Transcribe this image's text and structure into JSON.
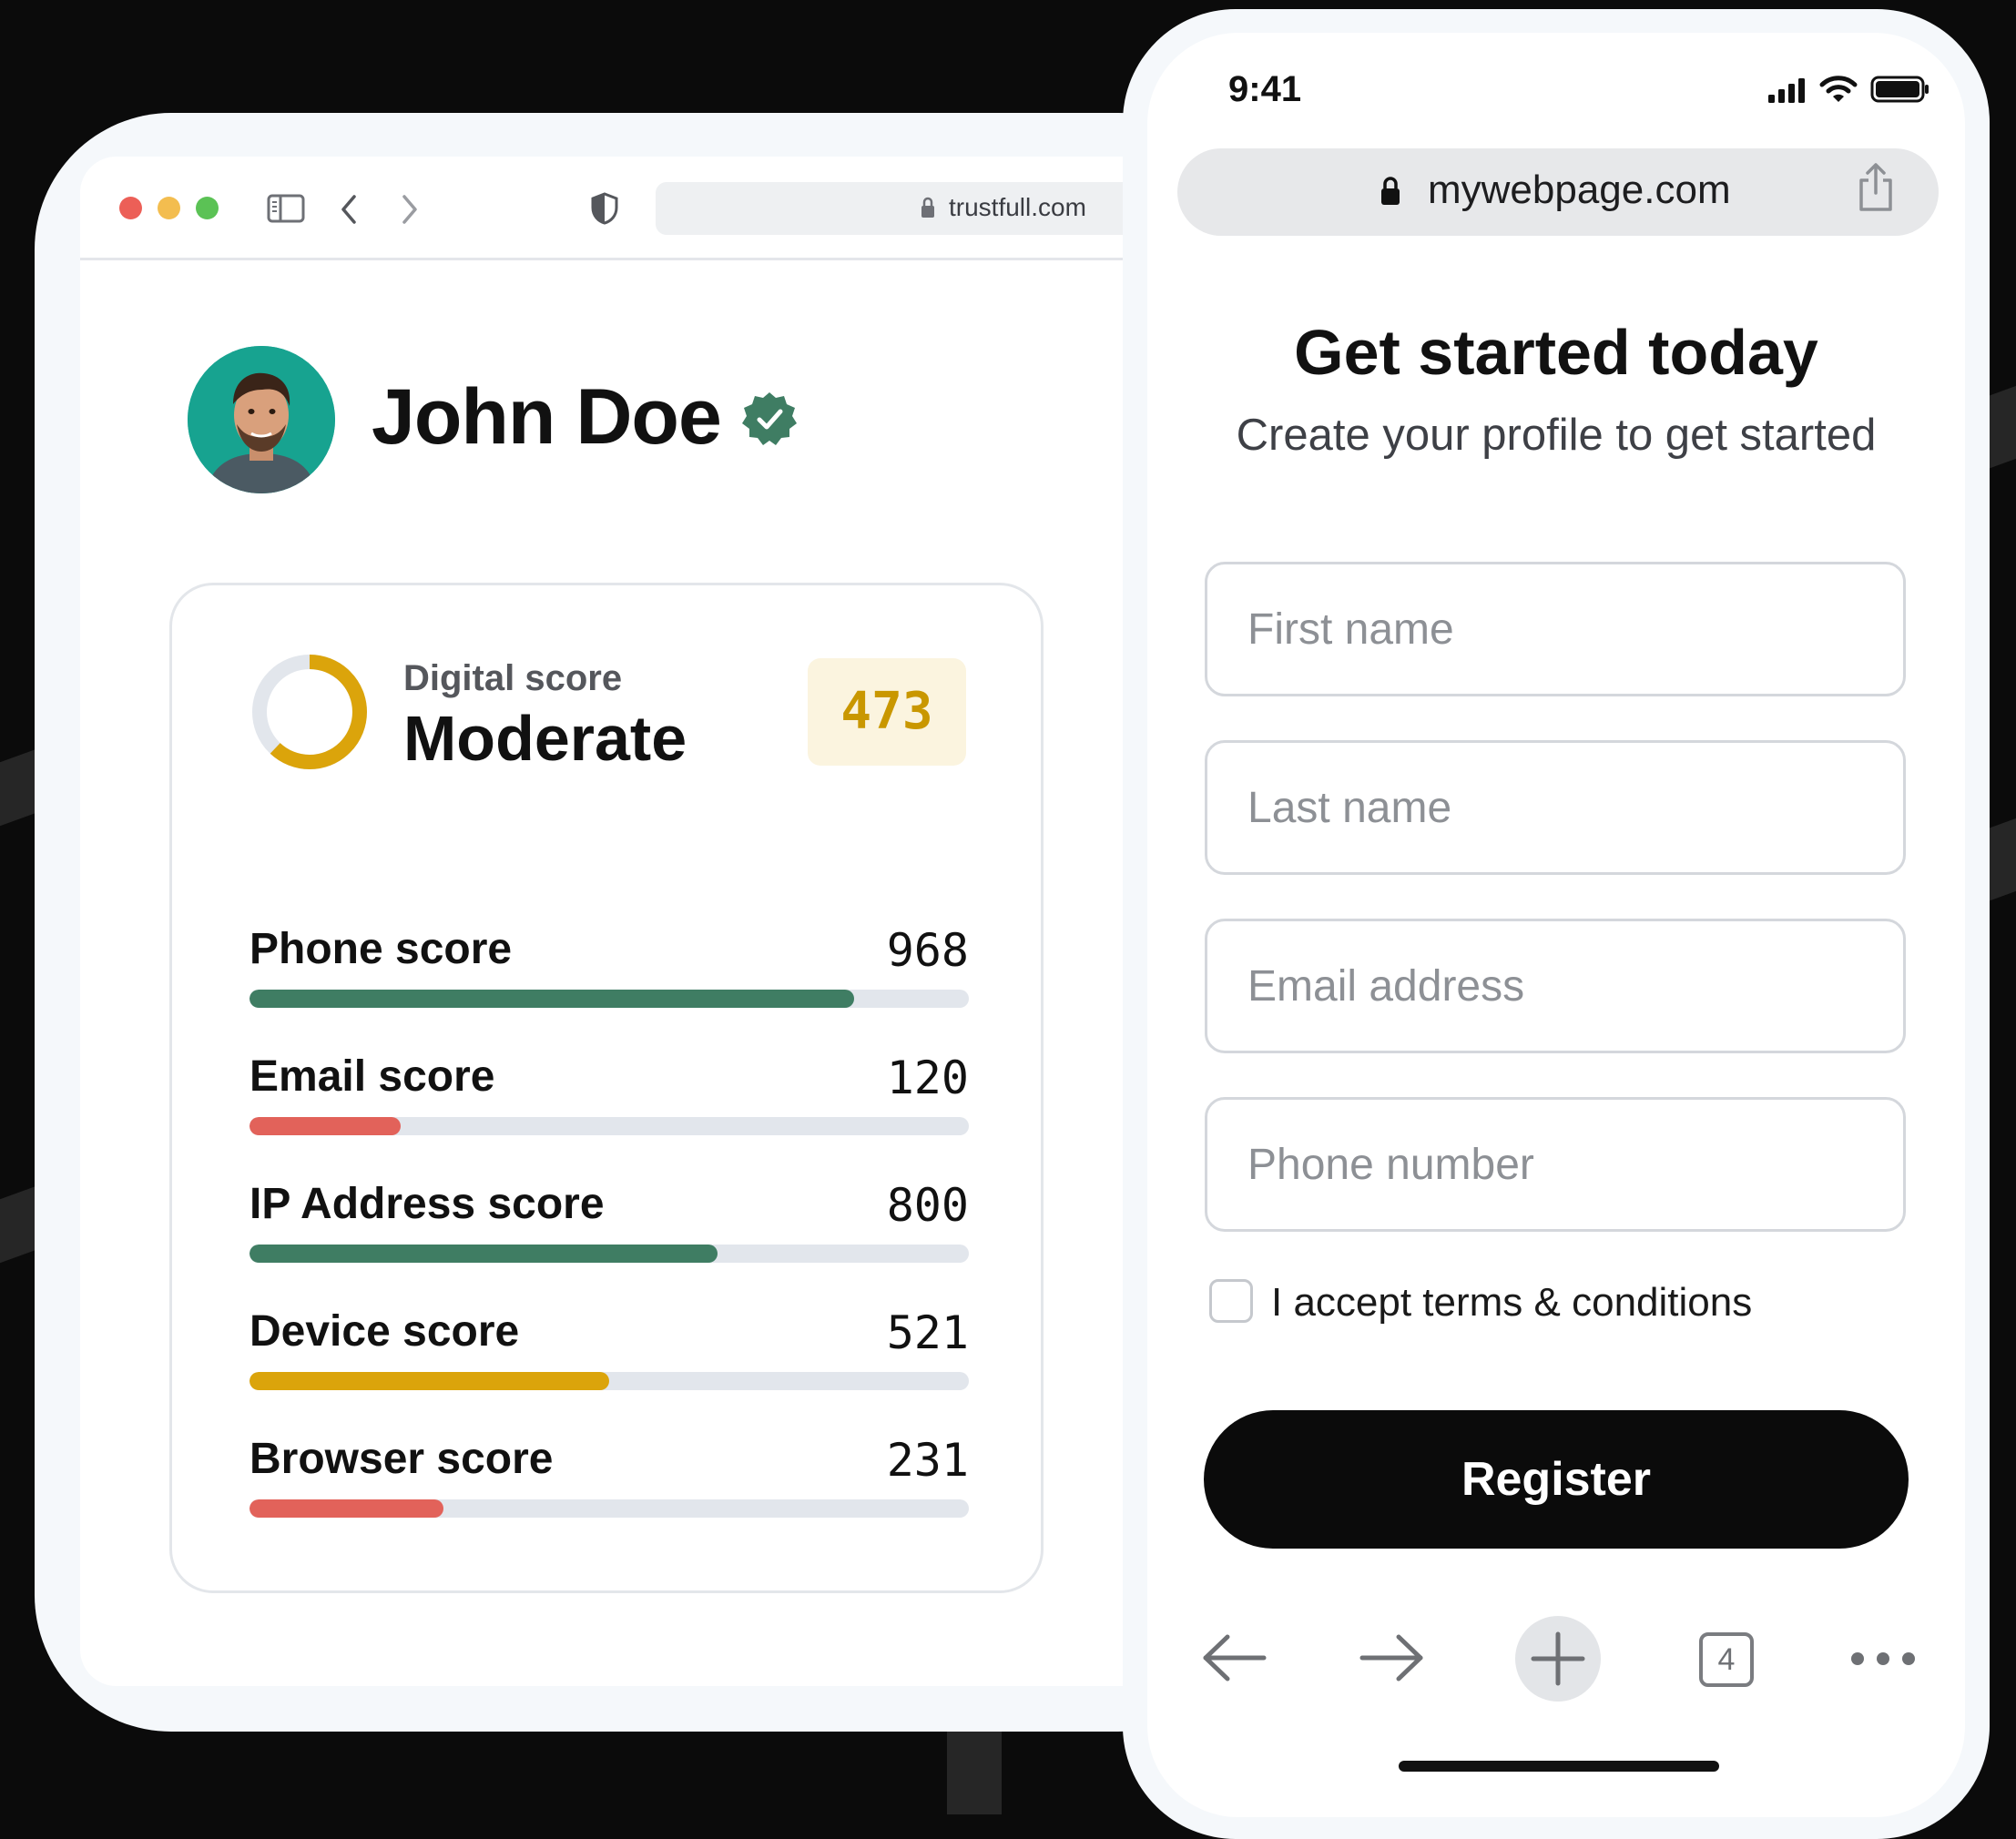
{
  "desktop": {
    "address_url": "trustfull.com",
    "profile": {
      "name": "John Doe",
      "verified": true,
      "avatar": "man-portrait-avatar"
    },
    "digital_score": {
      "label": "Digital score",
      "level": "Moderate",
      "value": "473",
      "ring_fraction": 0.62,
      "ring_color": "#dba40b"
    },
    "scores": [
      {
        "label": "Phone score",
        "value": "968",
        "fill": 0.84,
        "color": "#3f7d63"
      },
      {
        "label": "Email score",
        "value": "120",
        "fill": 0.21,
        "color": "#e2625a"
      },
      {
        "label": "IP Address score",
        "value": "800",
        "fill": 0.65,
        "color": "#3f7d63"
      },
      {
        "label": "Device score",
        "value": "521",
        "fill": 0.5,
        "color": "#dba40b"
      },
      {
        "label": "Browser score",
        "value": "231",
        "fill": 0.27,
        "color": "#e2625a"
      }
    ]
  },
  "phone": {
    "time": "9:41",
    "url": "mywebpage.com",
    "title": "Get started today",
    "subtitle": "Create your profile to get started",
    "fields": [
      {
        "placeholder": "First name",
        "value": ""
      },
      {
        "placeholder": "Last name",
        "value": ""
      },
      {
        "placeholder": "Email address",
        "value": ""
      },
      {
        "placeholder": "Phone number",
        "value": ""
      }
    ],
    "terms_label": "I accept terms & conditions",
    "terms_checked": false,
    "register_label": "Register",
    "tab_count": "4"
  },
  "colors": {
    "brand_green": "#3f7d63",
    "warn_red": "#e2625a",
    "amber": "#dba40b"
  }
}
